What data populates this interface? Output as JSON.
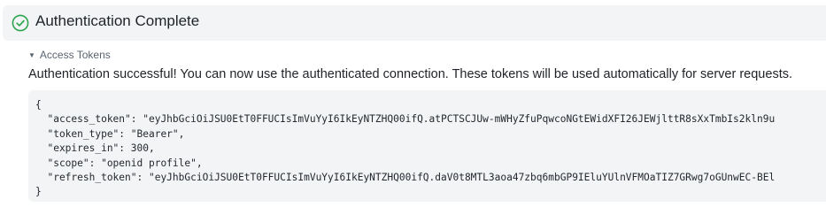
{
  "header": {
    "title": "Authentication Complete",
    "icon": "check-circle-icon",
    "accent": "#2da44e"
  },
  "section": {
    "label": "Access Tokens",
    "expanded": true
  },
  "message": "Authentication successful! You can now use the authenticated connection. These tokens will be used automatically for server requests.",
  "code": {
    "lines": [
      "{",
      "  \"access_token\": \"eyJhbGciOiJSU0EtT0FFUCIsImVuYyI6IkEyNTZHQ00ifQ.atPCTSCJUw-mWHyZfuPqwcoNGtEWidXFI26JEWjlttR8sXxTmbIs2kln9u",
      "  \"token_type\": \"Bearer\",",
      "  \"expires_in\": 300,",
      "  \"scope\": \"openid profile\",",
      "  \"refresh_token\": \"eyJhbGciOiJSU0EtT0FFUCIsImVuYyI6IkEyNTZHQ00ifQ.daV0t8MTL3aoa47zbq6mbGP9IEluYUlnVFMOaTIZ7GRwg7oGUnwEC-BEl",
      "}"
    ]
  }
}
